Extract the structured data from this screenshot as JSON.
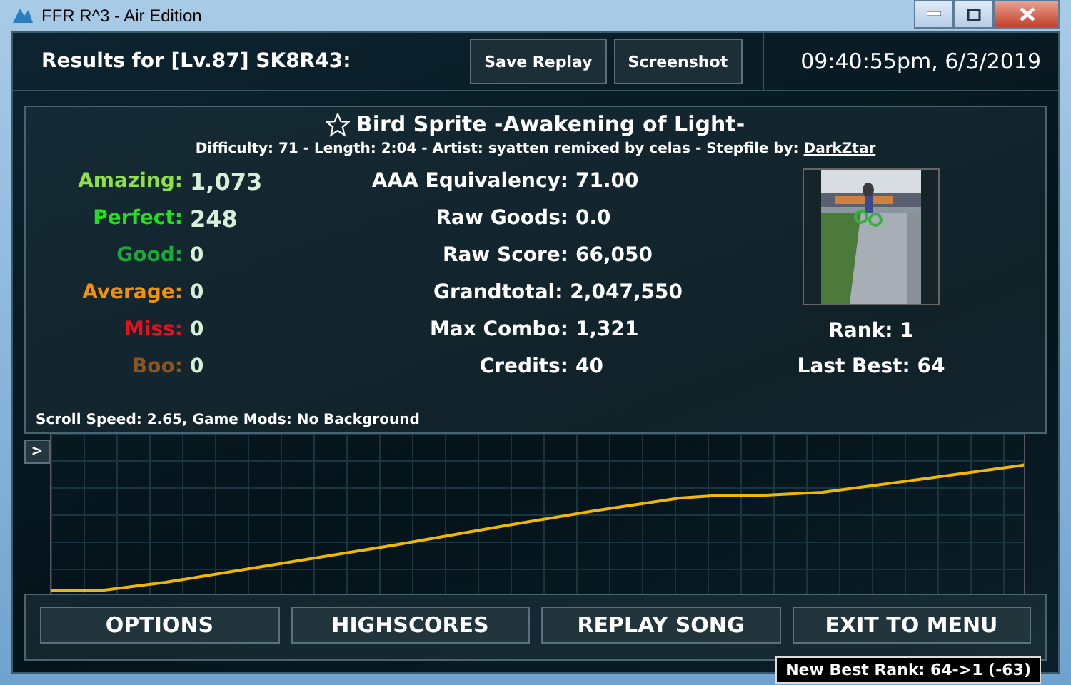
{
  "window": {
    "title": "FFR R^3 - Air Edition"
  },
  "header": {
    "results_title": "Results for [Lv.87] SK8R43:",
    "buttons": [
      "Save Replay",
      "Screenshot"
    ],
    "timestamp": "09:40:55pm, 6/3/2019"
  },
  "song": {
    "title": "Bird Sprite -Awakening of Light-",
    "details": "Difficulty: 71 - Length: 2:04 - Artist: syatten remixed by celas - Stepfile by:",
    "stepfile_author": "DarkZtar"
  },
  "judgements": [
    {
      "label": "Amazing:",
      "value": "1,073",
      "color": "#8ee04a"
    },
    {
      "label": "Perfect:",
      "value": "248",
      "color": "#22e01c"
    },
    {
      "label": "Good:",
      "value": "0",
      "color": "#1fa53a"
    },
    {
      "label": "Average:",
      "value": "0",
      "color": "#f0900c"
    },
    {
      "label": "Miss:",
      "value": "0",
      "color": "#e8101a"
    },
    {
      "label": "Boo:",
      "value": "0",
      "color": "#8a5520"
    }
  ],
  "stats": [
    {
      "label": "AAA Equivalency:",
      "value": "71.00"
    },
    {
      "label": "Raw Goods:",
      "value": "0.0"
    },
    {
      "label": "Raw Score:",
      "value": "66,050"
    },
    {
      "label": "Grandtotal:",
      "value": "2,047,550"
    },
    {
      "label": "Max Combo:",
      "value": "1,321"
    },
    {
      "label": "Credits:",
      "value": "40"
    }
  ],
  "rank": "Rank: 1",
  "last_best": "Last Best: 64",
  "settings_line": "Scroll Speed: 2.65, Game Mods: No Background",
  "graph": {
    "toggle": ">"
  },
  "nav_buttons": [
    "OPTIONS",
    "HIGHSCORES",
    "REPLAY SONG",
    "EXIT TO MENU"
  ],
  "tooltip": "New Best Rank: 64->1 (-63)"
}
